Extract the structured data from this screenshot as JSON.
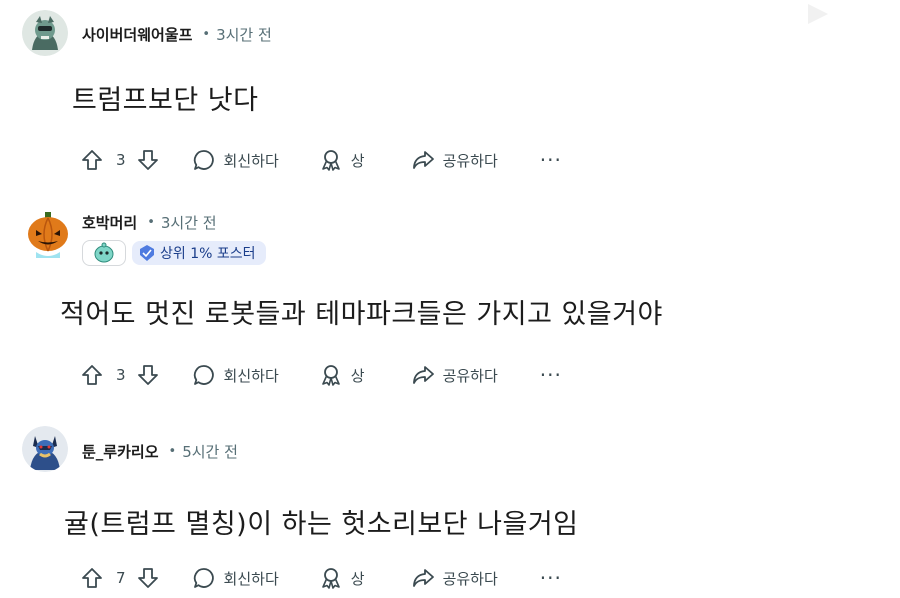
{
  "comments": [
    {
      "username": "사이버더웨어울프",
      "dot": "•",
      "time": "3시간 전",
      "text": "트럼프보단 낫다",
      "votes": "3",
      "reply_label": "회신하다",
      "award_label": "상",
      "share_label": "공유하다",
      "more_label": "···"
    },
    {
      "username": "호박머리",
      "dot": "•",
      "time": "3시간 전",
      "flair": "상위 1% 포스터",
      "text": "적어도 멋진 로봇들과 테마파크들은 가지고 있을거야",
      "votes": "3",
      "reply_label": "회신하다",
      "award_label": "상",
      "share_label": "공유하다",
      "more_label": "···"
    },
    {
      "username": "툰_루카리오",
      "dot": "•",
      "time": "5시간 전",
      "text": "귤(트럼프 멸칭)이 하는 헛소리보단 나을거임",
      "votes": "7",
      "reply_label": "회신하다",
      "award_label": "상",
      "share_label": "공유하다",
      "more_label": "···"
    }
  ],
  "colors": {
    "meta_gray": "#576f76",
    "action_gray": "#3b4a50",
    "flair_bg": "#e6ecfb",
    "flair_text": "#1a3d8a"
  }
}
